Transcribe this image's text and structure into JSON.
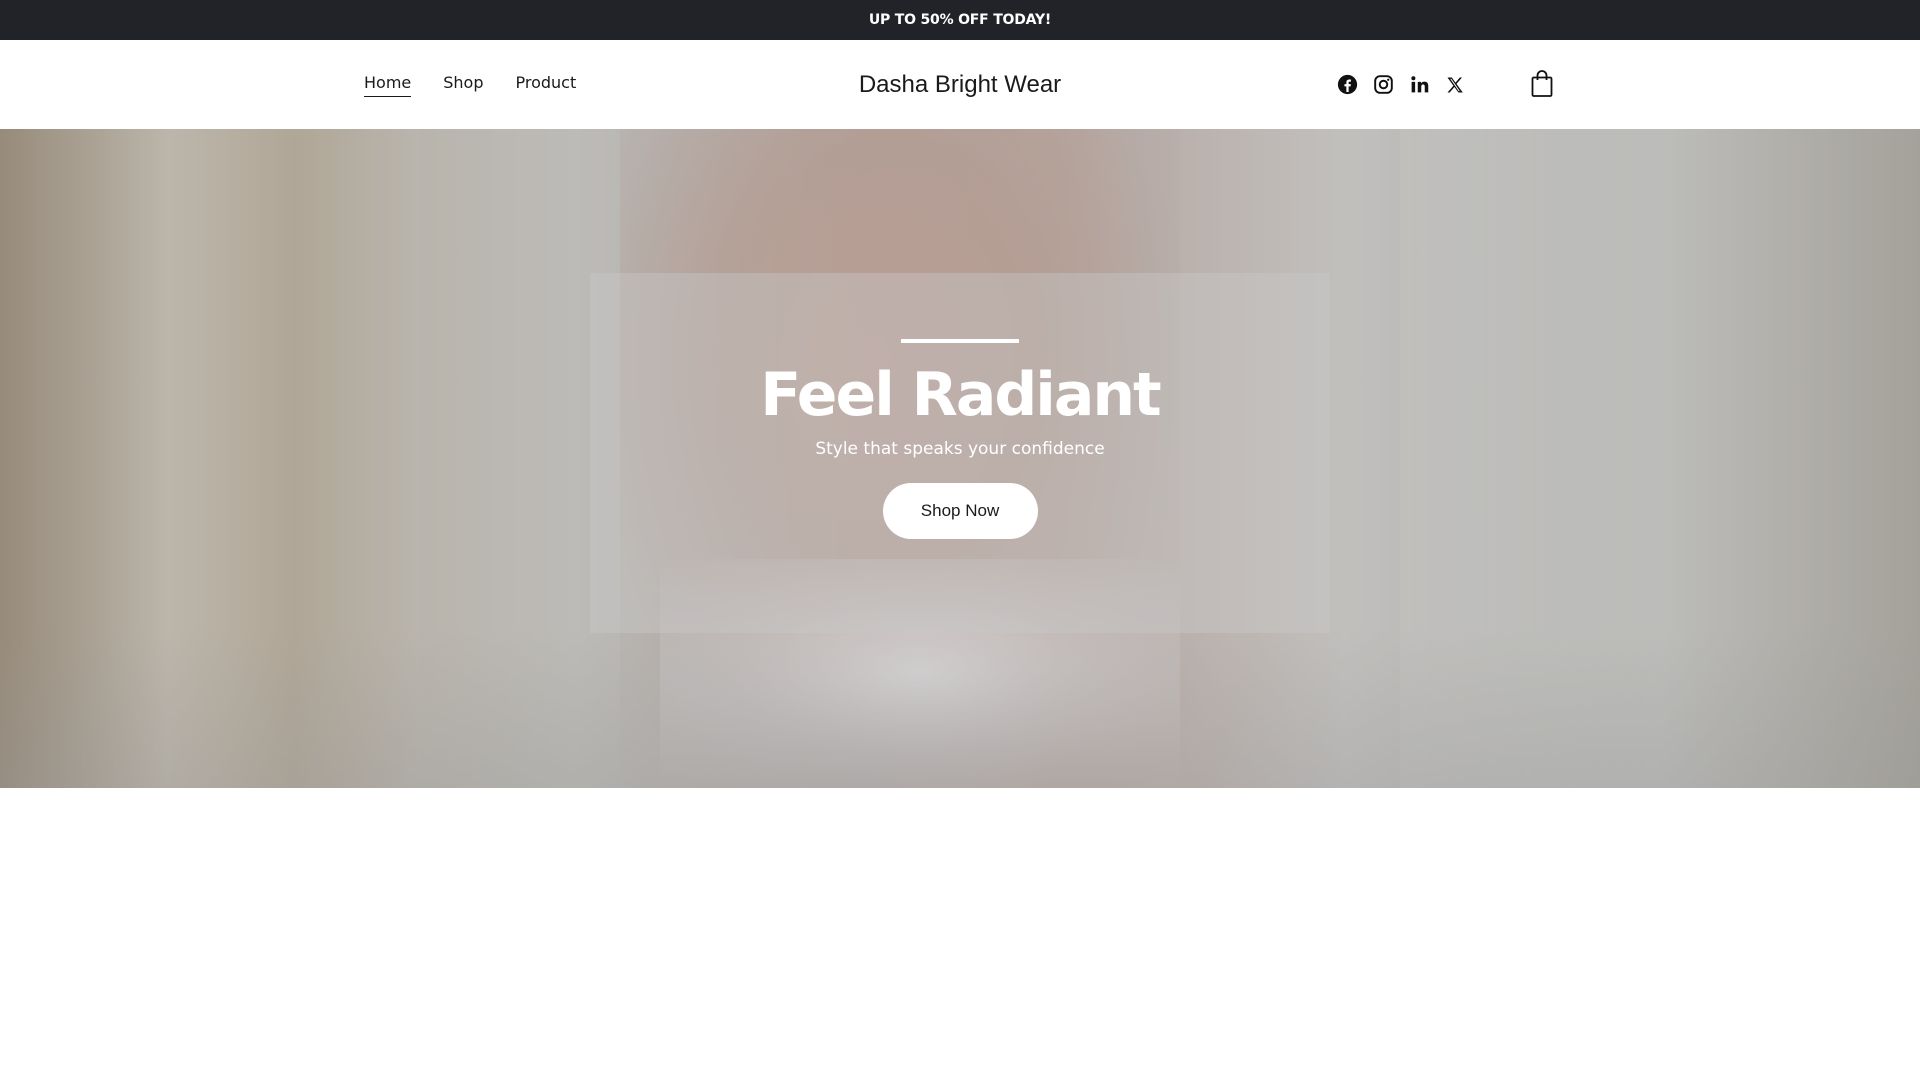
{
  "announcement": {
    "text": "UP TO 50% OFF TODAY!"
  },
  "header": {
    "nav": [
      {
        "label": "Home",
        "active": true
      },
      {
        "label": "Shop",
        "active": false
      },
      {
        "label": "Product",
        "active": false
      }
    ],
    "brand": "Dasha Bright Wear",
    "social_icons": [
      "facebook-icon",
      "instagram-icon",
      "linkedin-icon",
      "x-icon"
    ],
    "cart_icon": "shopping-bag-icon"
  },
  "hero": {
    "title": "Feel Radiant",
    "subtitle": "Style that speaks your confidence",
    "cta_label": "Shop Now"
  },
  "colors": {
    "announcement_bg": "#222328",
    "text_dark": "#1a1a1a",
    "white": "#ffffff"
  }
}
